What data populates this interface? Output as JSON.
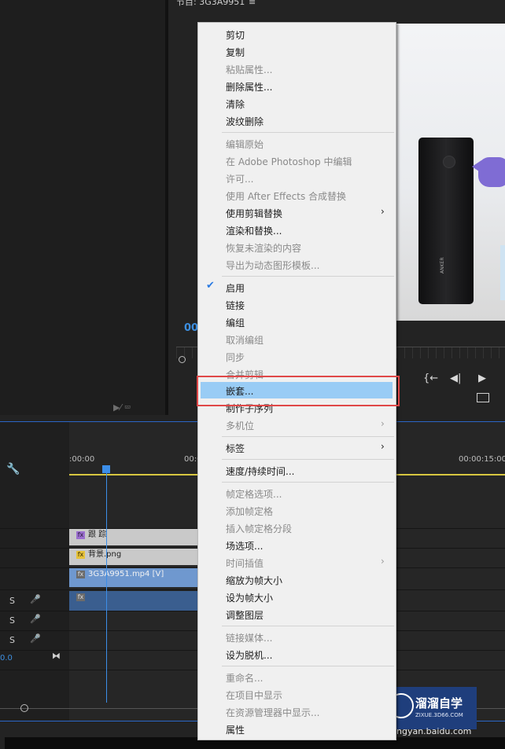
{
  "program": {
    "title": "节目: 3G3A9951",
    "menu_icon": "≡",
    "timecode_fragment": "00"
  },
  "left_panel": {
    "icons": "▶⁄ ⮹"
  },
  "video": {
    "device_brand": "ANKER"
  },
  "controls": {
    "goto_in": "{←",
    "step_back": "◀|",
    "play": "▶"
  },
  "timeline": {
    "ruler": {
      "start": ":00:00",
      "mid": "00:0",
      "end": "00:00:15:00"
    },
    "clips": [
      {
        "fx": "fx",
        "name": "跟 踪"
      },
      {
        "fx": "fx",
        "name": "背景.png"
      },
      {
        "fx": "fx",
        "name": "3G3A9951.mp4 [V]"
      },
      {
        "fx": "fx",
        "name": ""
      }
    ],
    "audio_tracks": [
      {
        "solo": "S"
      },
      {
        "solo": "S"
      },
      {
        "solo": "S"
      }
    ],
    "master_value": "0.0"
  },
  "context_menu": {
    "items": [
      "剪切",
      "复制",
      "粘贴属性...",
      "删除属性...",
      "清除",
      "波纹删除",
      "编辑原始",
      "在 Adobe Photoshop 中编辑",
      "许可...",
      "使用 After Effects 合成替换",
      "使用剪辑替换",
      "渲染和替换...",
      "恢复未渲染的内容",
      "导出为动态图形模板...",
      "启用",
      "链接",
      "编组",
      "取消编组",
      "同步",
      "合并剪辑",
      "嵌套...",
      "制作子序列",
      "多机位",
      "标签",
      "速度/持续时间...",
      "帧定格选项...",
      "添加帧定格",
      "插入帧定格分段",
      "场选项...",
      "时间插值",
      "缩放为帧大小",
      "设为帧大小",
      "调整图层",
      "链接媒体...",
      "设为脱机...",
      "重命名...",
      "在项目中显示",
      "在资源管理器中显示...",
      "属性"
    ],
    "highlighted": "嵌套...",
    "checked": "启用"
  },
  "watermark": {
    "title": "溜溜自学",
    "subtitle": "ZIXUE.3D66.COM",
    "site": "ngyan.baidu.com"
  }
}
